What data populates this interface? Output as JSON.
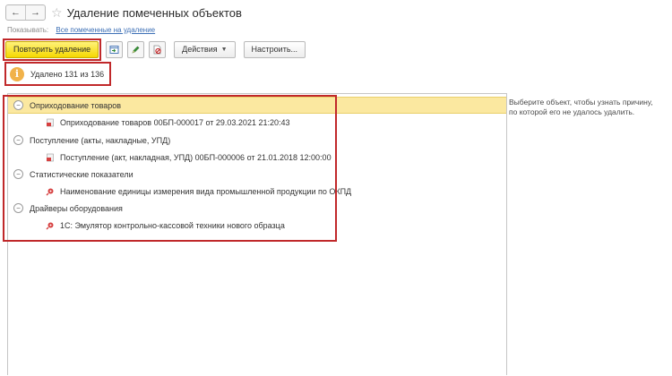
{
  "window": {
    "title": "Удаление помеченных объектов",
    "back_icon": "←",
    "forward_icon": "→",
    "favorite_icon": "☆"
  },
  "show": {
    "label": "Показывать:",
    "link": "Все помеченные на удаление"
  },
  "toolbar": {
    "repeat_label": "Повторить удаление",
    "actions_label": "Действия",
    "settings_label": "Настроить..."
  },
  "status": {
    "message": "Удалено 131 из 136"
  },
  "tree": {
    "groups": [
      {
        "label": "Оприходование товаров",
        "child": "Оприходование товаров 00БП-000017 от 29.03.2021 21:20:43",
        "child_icon": "document-icon"
      },
      {
        "label": "Поступление (акты, накладные, УПД)",
        "child": "Поступление (акт, накладная, УПД) 00БП-000006 от 21.01.2018 12:00:00",
        "child_icon": "document-icon"
      },
      {
        "label": "Статистические показатели",
        "child": "Наименование единицы измерения вида промышленной продукции по ОКПД",
        "child_icon": "catalog-item-icon"
      },
      {
        "label": "Драйверы оборудования",
        "child": "1С: Эмулятор контрольно-кассовой техники нового образца",
        "child_icon": "catalog-item-icon"
      }
    ]
  },
  "side_hint": {
    "line1": "Выберите объект, чтобы узнать причину,",
    "line2": "по которой его не удалось удалить."
  },
  "colors": {
    "accent_yellow": "#f5d800",
    "highlight_red": "#c0282a",
    "selection": "#fbe8a0",
    "link": "#3c6fb5"
  }
}
